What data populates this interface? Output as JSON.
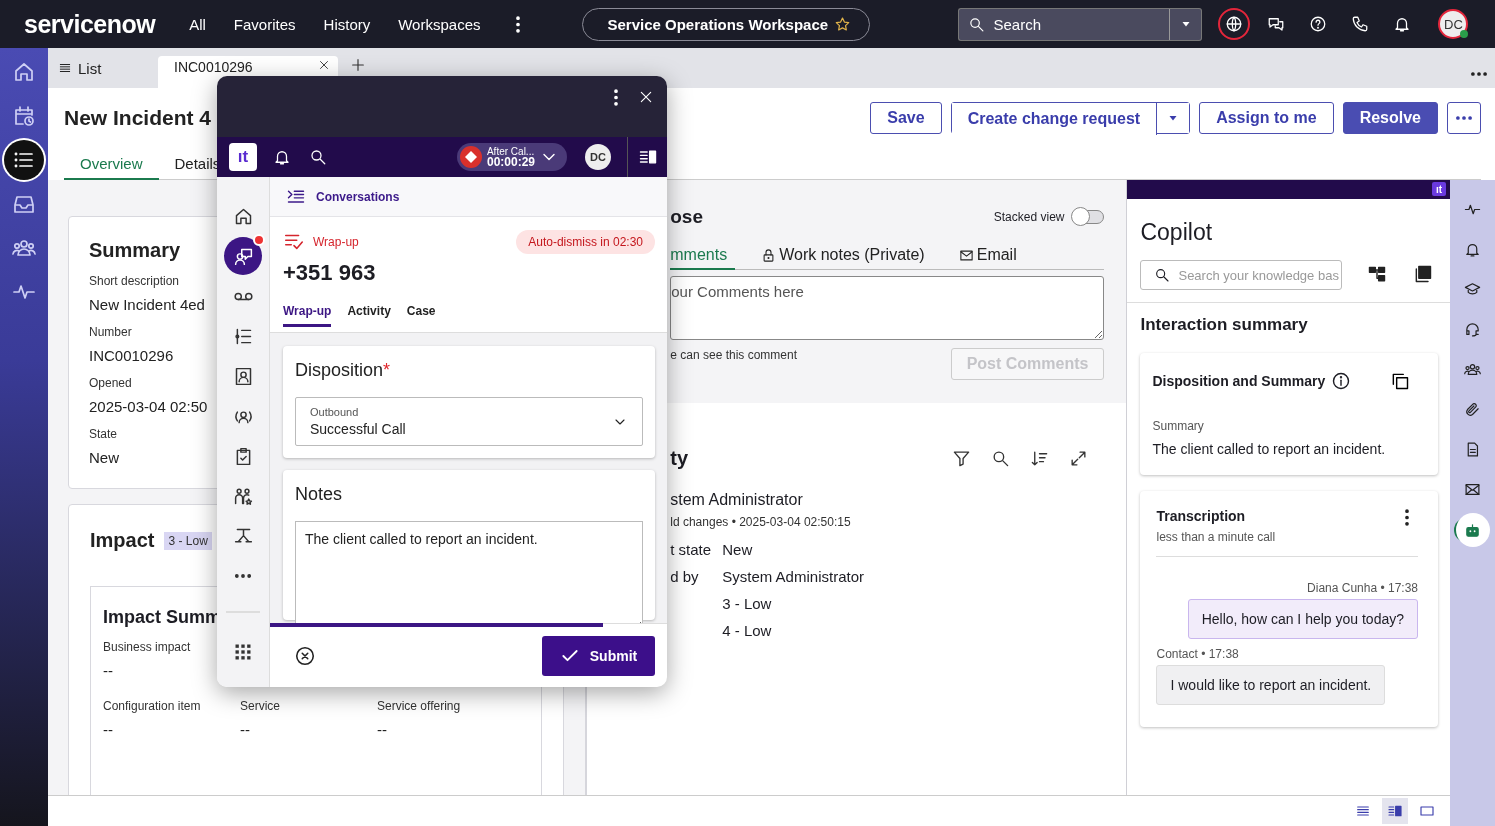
{
  "top_nav": {
    "logo": "servicenow",
    "menu": [
      "All",
      "Favorites",
      "History",
      "Workspaces"
    ],
    "workspace": "Service Operations Workspace",
    "search": {
      "placeholder": "Search"
    },
    "avatar": "DC",
    "tools": [
      {
        "kind": "globe",
        "selected": true
      },
      {
        "kind": "chat",
        "selected": false
      },
      {
        "kind": "help",
        "selected": false
      },
      {
        "kind": "phone",
        "selected": false
      },
      {
        "kind": "bell",
        "selected": false
      }
    ]
  },
  "app_rail": [
    {
      "kind": "home",
      "selected": false
    },
    {
      "kind": "calendar",
      "selected": false
    },
    {
      "kind": "list",
      "selected": true
    },
    {
      "kind": "inbox",
      "selected": false
    },
    {
      "kind": "people",
      "selected": false
    },
    {
      "kind": "pulse",
      "selected": false
    }
  ],
  "tab_strip": {
    "list_label": "List",
    "tabs": [
      {
        "label": "INC0010296",
        "selected": true
      }
    ]
  },
  "record": {
    "title": "New Incident 4",
    "actions": [
      {
        "label": "Save",
        "kind": "outline"
      },
      {
        "label": "Create change request",
        "kind": "split"
      },
      {
        "label": "Assign to me",
        "kind": "outline"
      },
      {
        "label": "Resolve",
        "kind": "primary"
      },
      {
        "kind": "more"
      }
    ],
    "tabs": [
      {
        "label": "Overview",
        "selected": true
      },
      {
        "label": "Details",
        "selected": false
      }
    ]
  },
  "summary": {
    "title": "Summary",
    "fields": [
      {
        "label": "Short description",
        "value": "New Incident 4ed"
      },
      {
        "label": "Number",
        "value": "INC0010296"
      },
      {
        "label": "Opened",
        "value": "2025-03-04 02:50"
      },
      {
        "label": "State",
        "value": "New"
      }
    ]
  },
  "impact": {
    "title": "Impact",
    "badge": "3 - Low",
    "inner_title": "Impact Summ",
    "business": {
      "label": "Business impact",
      "value": "--"
    },
    "fields": [
      {
        "label": "Configuration item",
        "value": "--"
      },
      {
        "label": "Service",
        "value": "--"
      },
      {
        "label": "Service offering",
        "value": "--"
      }
    ]
  },
  "compose": {
    "title": "ose",
    "stacked_view": {
      "label": "Stacked view",
      "on": false
    },
    "tabs": [
      {
        "label": "mments",
        "kind": "plain",
        "selected": true
      },
      {
        "label": "Work notes (Private)",
        "kind": "lock",
        "selected": false
      },
      {
        "label": "Email",
        "kind": "mail",
        "selected": false
      }
    ],
    "placeholder": "our Comments here",
    "note": "e can see this comment",
    "post_button": {
      "label": "Post Comments",
      "disabled": true
    }
  },
  "activity": {
    "title": "ty",
    "author": "stem Administrator",
    "meta": "ld changes • 2025-03-04 02:50:15",
    "fields": [
      {
        "label": "t state",
        "value": "New"
      },
      {
        "label": "d by",
        "value": "System Administrator"
      },
      {
        "value": "3 - Low"
      },
      {
        "value": "4 - Low"
      }
    ]
  },
  "copilot": {
    "logo": "ıt",
    "title": "Copilot",
    "search": {
      "placeholder": "Search your knowledge bas"
    },
    "section": "Interaction summary",
    "summary_card": {
      "title": "Disposition and Summary",
      "label": "Summary",
      "text": "The client called to report an incident."
    },
    "transcription": {
      "title": "Transcription",
      "subtitle": "less than a minute call",
      "messages": [
        {
          "sender": "Diana Cunha • 17:38",
          "text": "Hello, how can I help you today?",
          "kind": "agent"
        },
        {
          "sender": "Contact • 17:38",
          "text": "I would like to report an incident.",
          "kind": "contact"
        }
      ]
    }
  },
  "copilot_rail": [
    {
      "kind": "pulse",
      "selected": false
    },
    {
      "kind": "bell",
      "selected": false
    },
    {
      "kind": "cap",
      "selected": false
    },
    {
      "kind": "headset",
      "selected": false
    },
    {
      "kind": "people",
      "selected": false
    },
    {
      "kind": "clip",
      "selected": false
    },
    {
      "kind": "doc",
      "selected": false
    },
    {
      "kind": "mailplus",
      "selected": false
    },
    {
      "kind": "robot",
      "selected": true
    }
  ],
  "view_switcher": [
    {
      "kind": "lines",
      "selected": false
    },
    {
      "kind": "split",
      "selected": true
    },
    {
      "kind": "single",
      "selected": false
    }
  ],
  "softphone": {
    "logo": "ıt",
    "status": {
      "label": "After Cal...",
      "timer": "00:00:29"
    },
    "avatar": "DC",
    "nav": [
      {
        "kind": "home",
        "selected": false,
        "alert": false
      },
      {
        "kind": "convo",
        "selected": true,
        "alert": true
      },
      {
        "kind": "voicemail",
        "selected": false,
        "alert": false
      },
      {
        "kind": "steps",
        "selected": false,
        "alert": false
      },
      {
        "kind": "contact",
        "selected": false,
        "alert": false
      },
      {
        "kind": "agent",
        "selected": false,
        "alert": false
      },
      {
        "kind": "clipboard",
        "selected": false,
        "alert": false
      },
      {
        "kind": "team",
        "selected": false,
        "alert": false
      },
      {
        "kind": "route",
        "selected": false,
        "alert": false
      },
      {
        "kind": "dots",
        "selected": false,
        "alert": false
      }
    ],
    "header": "Conversations",
    "state": "Wrap-up",
    "auto_dismiss": "Auto-dismiss in 02:30",
    "number": "+351 963",
    "tabs": [
      {
        "label": "Wrap-up",
        "selected": true
      },
      {
        "label": "Activity",
        "selected": false
      },
      {
        "label": "Case",
        "selected": false
      }
    ],
    "disposition": {
      "title": "Disposition",
      "required": true,
      "required_mark": "*",
      "label": "Outbound",
      "value": "Successful Call"
    },
    "notes": {
      "title": "Notes",
      "value": "The client called to report an incident."
    },
    "progress": {
      "level": 0.84
    },
    "submit": "Submit"
  }
}
